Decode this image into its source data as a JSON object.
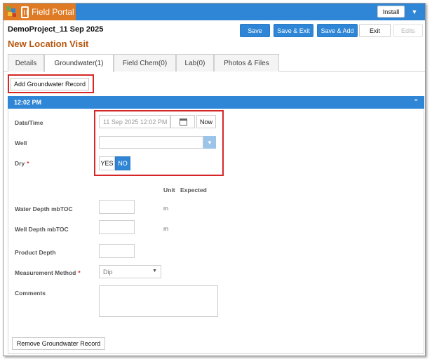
{
  "app": {
    "title": "Field Portal",
    "install_label": "Install",
    "menu_icon": "caret-down-icon"
  },
  "header": {
    "project": "DemoProject_11 Sep 2025",
    "page_title": "New Location Visit",
    "buttons": {
      "save": "Save",
      "save_exit": "Save & Exit",
      "save_add": "Save & Add",
      "exit": "Exit",
      "edits": "Edits"
    }
  },
  "tabs": [
    {
      "label": "Details",
      "active": false
    },
    {
      "label": "Groundwater(1)",
      "active": true
    },
    {
      "label": "Field Chem(0)",
      "active": false
    },
    {
      "label": "Lab(0)",
      "active": false
    },
    {
      "label": "Photos & Files",
      "active": false
    }
  ],
  "groundwater": {
    "add_label": "Add Groundwater Record",
    "remove_label": "Remove Groundwater Record",
    "record_title": "12:02 PM",
    "fields": {
      "datetime": {
        "label": "Date/Time",
        "value": "11 Sep 2025 12:02 PM",
        "now_label": "Now"
      },
      "well": {
        "label": "Well",
        "value": ""
      },
      "dry": {
        "label": "Dry",
        "required": "*",
        "yes": "YES",
        "no": "NO",
        "selected": "NO"
      },
      "columns": {
        "unit": "Unit",
        "expected": "Expected"
      },
      "water_depth": {
        "label": "Water Depth mbTOC",
        "value": "",
        "unit": "m"
      },
      "well_depth": {
        "label": "Well Depth mbTOC",
        "value": "",
        "unit": "m"
      },
      "product_depth": {
        "label": "Product Depth",
        "value": ""
      },
      "measurement_method": {
        "label": "Measurement Method",
        "required": "*",
        "value": "Dip"
      },
      "comments": {
        "label": "Comments",
        "value": ""
      }
    }
  },
  "colors": {
    "primary": "#2f86d6",
    "brand": "#e07b25",
    "title": "#b8560f",
    "highlight": "#d62728"
  }
}
